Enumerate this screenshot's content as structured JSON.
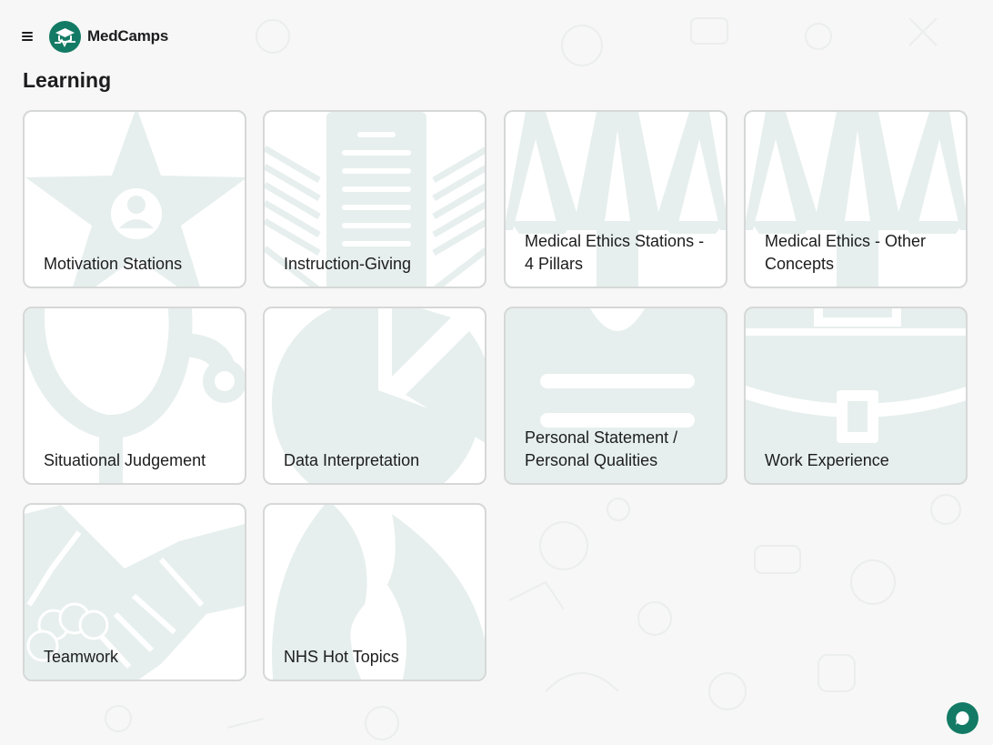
{
  "header": {
    "brand": "MedCamps",
    "menu_icon": "hamburger-icon",
    "logo_icon": "medcamps-logo"
  },
  "page": {
    "title": "Learning"
  },
  "colors": {
    "accent": "#137a65",
    "illustration": "#e6efed",
    "card_border": "#d6d8d7"
  },
  "cards": [
    {
      "label": "Motivation Stations",
      "icon": "star-person-icon"
    },
    {
      "label": "Instruction-Giving",
      "icon": "document-icon"
    },
    {
      "label": "Medical Ethics Stations - 4 Pillars",
      "icon": "pillars-icon"
    },
    {
      "label": "Medical Ethics - Other Concepts",
      "icon": "pillars-icon"
    },
    {
      "label": "Situational Judgement",
      "icon": "stethoscope-icon"
    },
    {
      "label": "Data Interpretation",
      "icon": "pie-chart-icon"
    },
    {
      "label": "Personal Statement / Personal Qualities",
      "icon": "id-badge-icon"
    },
    {
      "label": "Work Experience",
      "icon": "briefcase-icon"
    },
    {
      "label": "Teamwork",
      "icon": "handshake-icon"
    },
    {
      "label": "NHS Hot Topics",
      "icon": "flame-icon"
    }
  ],
  "chat": {
    "icon": "chat-bubble-icon"
  }
}
